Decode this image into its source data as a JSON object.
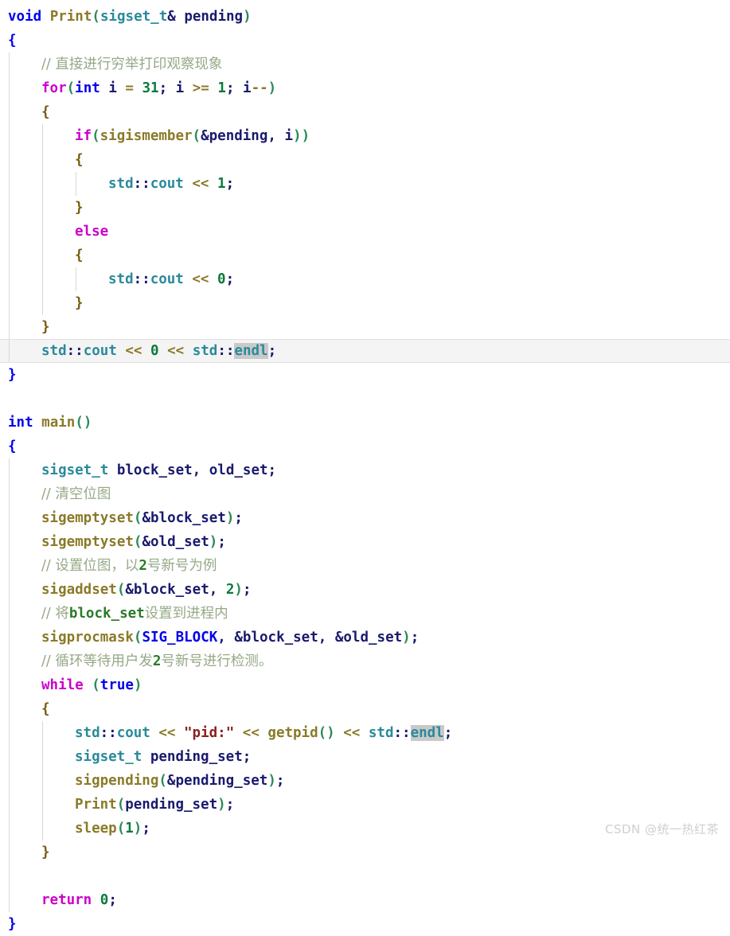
{
  "editor": {
    "language": "cpp",
    "theme": "light",
    "font_size_px": 17.5,
    "line_height_px": 30,
    "colors": {
      "background": "#ffffff",
      "default_text": "#202020",
      "keyword_control": "#cc00cc",
      "keyword_type": "#0000ee",
      "type_name": "#2a8a9a",
      "function_name": "#8a7a28",
      "identifier": "#1a1a6e",
      "number": "#0a7a3a",
      "operator": "#8a7a28",
      "paren": "#2a8a5a",
      "brace": "#7a5a10",
      "brace_matched": "#0000ee",
      "comment": "#96a887",
      "string": "#8a2020",
      "selection_highlight": "#c9c9c9",
      "current_line_band": "#f4f4f4",
      "indent_guide": "#d8d8d8",
      "watermark": "#cfcfcf"
    },
    "search_match_token": "endl",
    "current_line_number": 14
  },
  "code": {
    "lines": [
      {
        "n": 1,
        "indent": 0,
        "current": false,
        "tokens": [
          {
            "t": "void",
            "c": "kwb"
          },
          {
            "t": " ",
            "c": "plain"
          },
          {
            "t": "Print",
            "c": "fn"
          },
          {
            "t": "(",
            "c": "paren"
          },
          {
            "t": "sigset_t",
            "c": "type"
          },
          {
            "t": "&",
            "c": "ident"
          },
          {
            "t": " ",
            "c": "plain"
          },
          {
            "t": "pending",
            "c": "ident"
          },
          {
            "t": ")",
            "c": "paren"
          }
        ]
      },
      {
        "n": 2,
        "indent": 0,
        "current": false,
        "tokens": [
          {
            "t": "{",
            "c": "brace-m"
          }
        ]
      },
      {
        "n": 3,
        "indent": 1,
        "current": false,
        "tokens": [
          {
            "t": "// 直接进行穷举打印观察现象",
            "c": "cmt"
          }
        ]
      },
      {
        "n": 4,
        "indent": 1,
        "current": false,
        "tokens": [
          {
            "t": "for",
            "c": "kw"
          },
          {
            "t": "(",
            "c": "paren"
          },
          {
            "t": "int",
            "c": "kwb"
          },
          {
            "t": " ",
            "c": "plain"
          },
          {
            "t": "i",
            "c": "ident"
          },
          {
            "t": " ",
            "c": "plain"
          },
          {
            "t": "=",
            "c": "op"
          },
          {
            "t": " ",
            "c": "plain"
          },
          {
            "t": "31",
            "c": "num"
          },
          {
            "t": ";",
            "c": "semi"
          },
          {
            "t": " ",
            "c": "plain"
          },
          {
            "t": "i",
            "c": "ident"
          },
          {
            "t": " ",
            "c": "plain"
          },
          {
            "t": ">=",
            "c": "op"
          },
          {
            "t": " ",
            "c": "plain"
          },
          {
            "t": "1",
            "c": "num"
          },
          {
            "t": ";",
            "c": "semi"
          },
          {
            "t": " ",
            "c": "plain"
          },
          {
            "t": "i",
            "c": "ident"
          },
          {
            "t": "--",
            "c": "op"
          },
          {
            "t": ")",
            "c": "paren"
          }
        ]
      },
      {
        "n": 5,
        "indent": 1,
        "current": false,
        "tokens": [
          {
            "t": "{",
            "c": "brace"
          }
        ]
      },
      {
        "n": 6,
        "indent": 2,
        "current": false,
        "tokens": [
          {
            "t": "if",
            "c": "kw"
          },
          {
            "t": "(",
            "c": "paren"
          },
          {
            "t": "sigismember",
            "c": "fn"
          },
          {
            "t": "(",
            "c": "paren"
          },
          {
            "t": "&",
            "c": "ident"
          },
          {
            "t": "pending",
            "c": "ident"
          },
          {
            "t": ",",
            "c": "ident"
          },
          {
            "t": " ",
            "c": "plain"
          },
          {
            "t": "i",
            "c": "ident"
          },
          {
            "t": "))",
            "c": "paren"
          }
        ]
      },
      {
        "n": 7,
        "indent": 2,
        "current": false,
        "tokens": [
          {
            "t": "{",
            "c": "brace"
          }
        ]
      },
      {
        "n": 8,
        "indent": 3,
        "current": false,
        "tokens": [
          {
            "t": "std",
            "c": "type"
          },
          {
            "t": "::",
            "c": "ident"
          },
          {
            "t": "cout",
            "c": "type"
          },
          {
            "t": " ",
            "c": "plain"
          },
          {
            "t": "<<",
            "c": "op"
          },
          {
            "t": " ",
            "c": "plain"
          },
          {
            "t": "1",
            "c": "num"
          },
          {
            "t": ";",
            "c": "semi"
          }
        ]
      },
      {
        "n": 9,
        "indent": 2,
        "current": false,
        "tokens": [
          {
            "t": "}",
            "c": "brace"
          }
        ]
      },
      {
        "n": 10,
        "indent": 2,
        "current": false,
        "tokens": [
          {
            "t": "else",
            "c": "kw"
          }
        ]
      },
      {
        "n": 11,
        "indent": 2,
        "current": false,
        "tokens": [
          {
            "t": "{",
            "c": "brace"
          }
        ]
      },
      {
        "n": 12,
        "indent": 3,
        "current": false,
        "tokens": [
          {
            "t": "std",
            "c": "type"
          },
          {
            "t": "::",
            "c": "ident"
          },
          {
            "t": "cout",
            "c": "type"
          },
          {
            "t": " ",
            "c": "plain"
          },
          {
            "t": "<<",
            "c": "op"
          },
          {
            "t": " ",
            "c": "plain"
          },
          {
            "t": "0",
            "c": "num"
          },
          {
            "t": ";",
            "c": "semi"
          }
        ]
      },
      {
        "n": 13,
        "indent": 2,
        "current": false,
        "tokens": [
          {
            "t": "}",
            "c": "brace"
          }
        ]
      },
      {
        "n": 14,
        "indent": 1,
        "current": false,
        "tokens": [
          {
            "t": "}",
            "c": "brace"
          }
        ]
      },
      {
        "n": 15,
        "indent": 1,
        "current": true,
        "tokens": [
          {
            "t": "std",
            "c": "type"
          },
          {
            "t": "::",
            "c": "ident"
          },
          {
            "t": "cout",
            "c": "type"
          },
          {
            "t": " ",
            "c": "plain"
          },
          {
            "t": "<<",
            "c": "op"
          },
          {
            "t": " ",
            "c": "plain"
          },
          {
            "t": "0",
            "c": "num"
          },
          {
            "t": " ",
            "c": "plain"
          },
          {
            "t": "<<",
            "c": "op"
          },
          {
            "t": " ",
            "c": "plain"
          },
          {
            "t": "std",
            "c": "type"
          },
          {
            "t": "::",
            "c": "ident"
          },
          {
            "t": "endl",
            "c": "type sel"
          },
          {
            "t": ";",
            "c": "semi"
          }
        ]
      },
      {
        "n": 16,
        "indent": 0,
        "current": false,
        "tokens": [
          {
            "t": "}",
            "c": "brace-m"
          }
        ]
      },
      {
        "n": 17,
        "indent": 0,
        "current": false,
        "tokens": []
      },
      {
        "n": 18,
        "indent": 0,
        "current": false,
        "tokens": [
          {
            "t": "int",
            "c": "kwb"
          },
          {
            "t": " ",
            "c": "plain"
          },
          {
            "t": "main",
            "c": "fn"
          },
          {
            "t": "()",
            "c": "paren"
          }
        ]
      },
      {
        "n": 19,
        "indent": 0,
        "current": false,
        "tokens": [
          {
            "t": "{",
            "c": "brace-m"
          }
        ]
      },
      {
        "n": 20,
        "indent": 1,
        "current": false,
        "tokens": [
          {
            "t": "sigset_t",
            "c": "type"
          },
          {
            "t": " ",
            "c": "plain"
          },
          {
            "t": "block_set",
            "c": "ident"
          },
          {
            "t": ",",
            "c": "ident"
          },
          {
            "t": " ",
            "c": "plain"
          },
          {
            "t": "old_set",
            "c": "ident"
          },
          {
            "t": ";",
            "c": "semi"
          }
        ]
      },
      {
        "n": 21,
        "indent": 1,
        "current": false,
        "tokens": [
          {
            "t": "// 清空位图",
            "c": "cmt"
          }
        ]
      },
      {
        "n": 22,
        "indent": 1,
        "current": false,
        "tokens": [
          {
            "t": "sigemptyset",
            "c": "fn"
          },
          {
            "t": "(",
            "c": "paren"
          },
          {
            "t": "&",
            "c": "ident"
          },
          {
            "t": "block_set",
            "c": "ident"
          },
          {
            "t": ")",
            "c": "paren"
          },
          {
            "t": ";",
            "c": "semi"
          }
        ]
      },
      {
        "n": 23,
        "indent": 1,
        "current": false,
        "tokens": [
          {
            "t": "sigemptyset",
            "c": "fn"
          },
          {
            "t": "(",
            "c": "paren"
          },
          {
            "t": "&",
            "c": "ident"
          },
          {
            "t": "old_set",
            "c": "ident"
          },
          {
            "t": ")",
            "c": "paren"
          },
          {
            "t": ";",
            "c": "semi"
          }
        ]
      },
      {
        "n": 24,
        "indent": 1,
        "current": false,
        "tokens": [
          {
            "t": "// 设置位图，以",
            "c": "cmt"
          },
          {
            "t": "2",
            "c": "cmt-b"
          },
          {
            "t": "号新号为例",
            "c": "cmt"
          }
        ]
      },
      {
        "n": 25,
        "indent": 1,
        "current": false,
        "tokens": [
          {
            "t": "sigaddset",
            "c": "fn"
          },
          {
            "t": "(",
            "c": "paren"
          },
          {
            "t": "&",
            "c": "ident"
          },
          {
            "t": "block_set",
            "c": "ident"
          },
          {
            "t": ",",
            "c": "ident"
          },
          {
            "t": " ",
            "c": "plain"
          },
          {
            "t": "2",
            "c": "num"
          },
          {
            "t": ")",
            "c": "paren"
          },
          {
            "t": ";",
            "c": "semi"
          }
        ]
      },
      {
        "n": 26,
        "indent": 1,
        "current": false,
        "tokens": [
          {
            "t": "// 将",
            "c": "cmt"
          },
          {
            "t": "block_set",
            "c": "cmt-b"
          },
          {
            "t": "设置到进程内",
            "c": "cmt"
          }
        ]
      },
      {
        "n": 27,
        "indent": 1,
        "current": false,
        "tokens": [
          {
            "t": "sigprocmask",
            "c": "fn"
          },
          {
            "t": "(",
            "c": "paren"
          },
          {
            "t": "SIG_BLOCK",
            "c": "kwb"
          },
          {
            "t": ",",
            "c": "ident"
          },
          {
            "t": " ",
            "c": "plain"
          },
          {
            "t": "&",
            "c": "ident"
          },
          {
            "t": "block_set",
            "c": "ident"
          },
          {
            "t": ",",
            "c": "ident"
          },
          {
            "t": " ",
            "c": "plain"
          },
          {
            "t": "&",
            "c": "ident"
          },
          {
            "t": "old_set",
            "c": "ident"
          },
          {
            "t": ")",
            "c": "paren"
          },
          {
            "t": ";",
            "c": "semi"
          }
        ]
      },
      {
        "n": 28,
        "indent": 1,
        "current": false,
        "tokens": [
          {
            "t": "// 循环等待用户发",
            "c": "cmt"
          },
          {
            "t": "2",
            "c": "cmt-b"
          },
          {
            "t": "号新号进行检测。",
            "c": "cmt"
          }
        ]
      },
      {
        "n": 29,
        "indent": 1,
        "current": false,
        "tokens": [
          {
            "t": "while",
            "c": "kw"
          },
          {
            "t": " ",
            "c": "plain"
          },
          {
            "t": "(",
            "c": "paren"
          },
          {
            "t": "true",
            "c": "kwb"
          },
          {
            "t": ")",
            "c": "paren"
          }
        ]
      },
      {
        "n": 30,
        "indent": 1,
        "current": false,
        "tokens": [
          {
            "t": "{",
            "c": "brace"
          }
        ]
      },
      {
        "n": 31,
        "indent": 2,
        "current": false,
        "tokens": [
          {
            "t": "std",
            "c": "type"
          },
          {
            "t": "::",
            "c": "ident"
          },
          {
            "t": "cout",
            "c": "type"
          },
          {
            "t": " ",
            "c": "plain"
          },
          {
            "t": "<<",
            "c": "op"
          },
          {
            "t": " ",
            "c": "plain"
          },
          {
            "t": "\"pid:\"",
            "c": "str"
          },
          {
            "t": " ",
            "c": "plain"
          },
          {
            "t": "<<",
            "c": "op"
          },
          {
            "t": " ",
            "c": "plain"
          },
          {
            "t": "getpid",
            "c": "fn"
          },
          {
            "t": "()",
            "c": "paren"
          },
          {
            "t": " ",
            "c": "plain"
          },
          {
            "t": "<<",
            "c": "op"
          },
          {
            "t": " ",
            "c": "plain"
          },
          {
            "t": "std",
            "c": "type"
          },
          {
            "t": "::",
            "c": "ident"
          },
          {
            "t": "endl",
            "c": "type sel"
          },
          {
            "t": ";",
            "c": "semi"
          }
        ]
      },
      {
        "n": 32,
        "indent": 2,
        "current": false,
        "tokens": [
          {
            "t": "sigset_t",
            "c": "type"
          },
          {
            "t": " ",
            "c": "plain"
          },
          {
            "t": "pending_set",
            "c": "ident"
          },
          {
            "t": ";",
            "c": "semi"
          }
        ]
      },
      {
        "n": 33,
        "indent": 2,
        "current": false,
        "tokens": [
          {
            "t": "sigpending",
            "c": "fn"
          },
          {
            "t": "(",
            "c": "paren"
          },
          {
            "t": "&",
            "c": "ident"
          },
          {
            "t": "pending_set",
            "c": "ident"
          },
          {
            "t": ")",
            "c": "paren"
          },
          {
            "t": ";",
            "c": "semi"
          }
        ]
      },
      {
        "n": 34,
        "indent": 2,
        "current": false,
        "tokens": [
          {
            "t": "Print",
            "c": "fn"
          },
          {
            "t": "(",
            "c": "paren"
          },
          {
            "t": "pending_set",
            "c": "ident"
          },
          {
            "t": ")",
            "c": "paren"
          },
          {
            "t": ";",
            "c": "semi"
          }
        ]
      },
      {
        "n": 35,
        "indent": 2,
        "current": false,
        "tokens": [
          {
            "t": "sleep",
            "c": "fn"
          },
          {
            "t": "(",
            "c": "paren"
          },
          {
            "t": "1",
            "c": "num"
          },
          {
            "t": ")",
            "c": "paren"
          },
          {
            "t": ";",
            "c": "semi"
          }
        ]
      },
      {
        "n": 36,
        "indent": 1,
        "current": false,
        "tokens": [
          {
            "t": "}",
            "c": "brace"
          }
        ]
      },
      {
        "n": 37,
        "indent": 1,
        "current": false,
        "tokens": []
      },
      {
        "n": 38,
        "indent": 1,
        "current": false,
        "tokens": [
          {
            "t": "return",
            "c": "kw"
          },
          {
            "t": " ",
            "c": "plain"
          },
          {
            "t": "0",
            "c": "num"
          },
          {
            "t": ";",
            "c": "semi"
          }
        ]
      },
      {
        "n": 39,
        "indent": 0,
        "current": false,
        "tokens": [
          {
            "t": "}",
            "c": "brace-m"
          }
        ]
      }
    ]
  },
  "watermark": {
    "text": "CSDN @统一热红茶"
  }
}
